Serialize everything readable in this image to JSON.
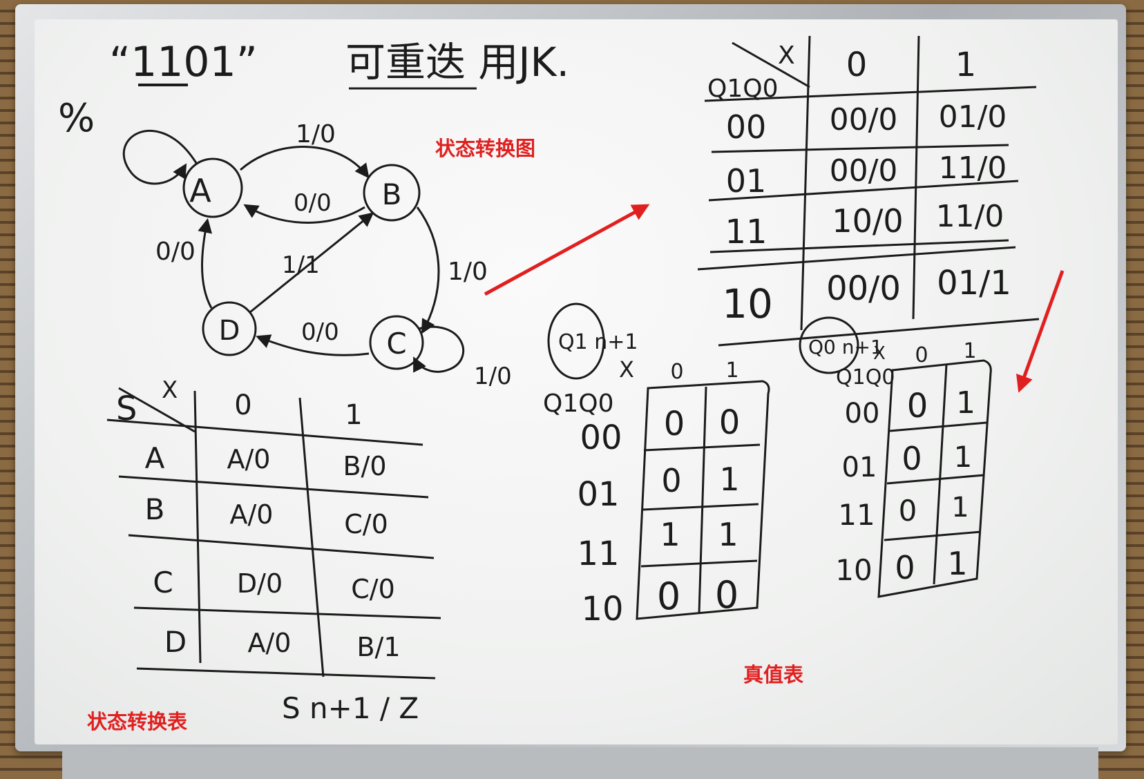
{
  "board": {
    "title_quote": "“1101”",
    "title_note": "可重迭 用JK.",
    "corner_mark": "%",
    "annotations": {
      "state_diagram": "状态转换图",
      "state_table": "状态转换表",
      "truth_table": "真值表"
    },
    "colors": {
      "annotation": "#e02020",
      "ink": "#1b1b1b",
      "board": "#f3f4f3"
    }
  },
  "state_diagram": {
    "states": [
      "A",
      "B",
      "C",
      "D"
    ],
    "edges": [
      {
        "from": "A",
        "to": "A",
        "label": ""
      },
      {
        "from": "A",
        "to": "B",
        "label": "1/0"
      },
      {
        "from": "B",
        "to": "A",
        "label": "0/0"
      },
      {
        "from": "B",
        "to": "C",
        "label": "1/0"
      },
      {
        "from": "C",
        "to": "C",
        "label": "1/0"
      },
      {
        "from": "C",
        "to": "D",
        "label": "0/0"
      },
      {
        "from": "D",
        "to": "A",
        "label": "0/0"
      },
      {
        "from": "D",
        "to": "B",
        "label": "1/1"
      }
    ]
  },
  "state_table": {
    "corner_row": "S",
    "corner_col": "X",
    "columns": [
      "0",
      "1"
    ],
    "rows": [
      {
        "state": "A",
        "cells": [
          "A/0",
          "B/0"
        ]
      },
      {
        "state": "B",
        "cells": [
          "A/0",
          "C/0"
        ]
      },
      {
        "state": "C",
        "cells": [
          "D/0",
          "C/0"
        ]
      },
      {
        "state": "D",
        "cells": [
          "A/0",
          "B/1"
        ]
      }
    ],
    "footer": "S n+1 / Z"
  },
  "encoded_table": {
    "corner_row": "Q1Q0",
    "corner_col": "X",
    "columns": [
      "0",
      "1"
    ],
    "rows": [
      {
        "code": "00",
        "cells": [
          "00/0",
          "01/0"
        ]
      },
      {
        "code": "01",
        "cells": [
          "00/0",
          "11/0"
        ]
      },
      {
        "code": "11",
        "cells": [
          "10/0",
          "11/0"
        ]
      },
      {
        "code": "10",
        "cells": [
          "00/0",
          "01/1"
        ]
      }
    ]
  },
  "truth_table_q1": {
    "title": "Q1 n+1",
    "corner_row": "Q1Q0",
    "corner_col": "X",
    "columns": [
      "0",
      "1"
    ],
    "row_codes": [
      "00",
      "01",
      "11",
      "10"
    ],
    "rows": [
      [
        "0",
        "0"
      ],
      [
        "0",
        "1"
      ],
      [
        "1",
        "1"
      ],
      [
        "0",
        "0"
      ]
    ]
  },
  "truth_table_q0": {
    "title": "Q0 n+1",
    "corner_row": "Q1Q0",
    "corner_col": "X",
    "columns": [
      "0",
      "1"
    ],
    "row_codes": [
      "00",
      "01",
      "11",
      "10"
    ],
    "rows": [
      [
        "0",
        "1"
      ],
      [
        "0",
        "1"
      ],
      [
        "0",
        "1"
      ],
      [
        "0",
        "1"
      ]
    ]
  }
}
